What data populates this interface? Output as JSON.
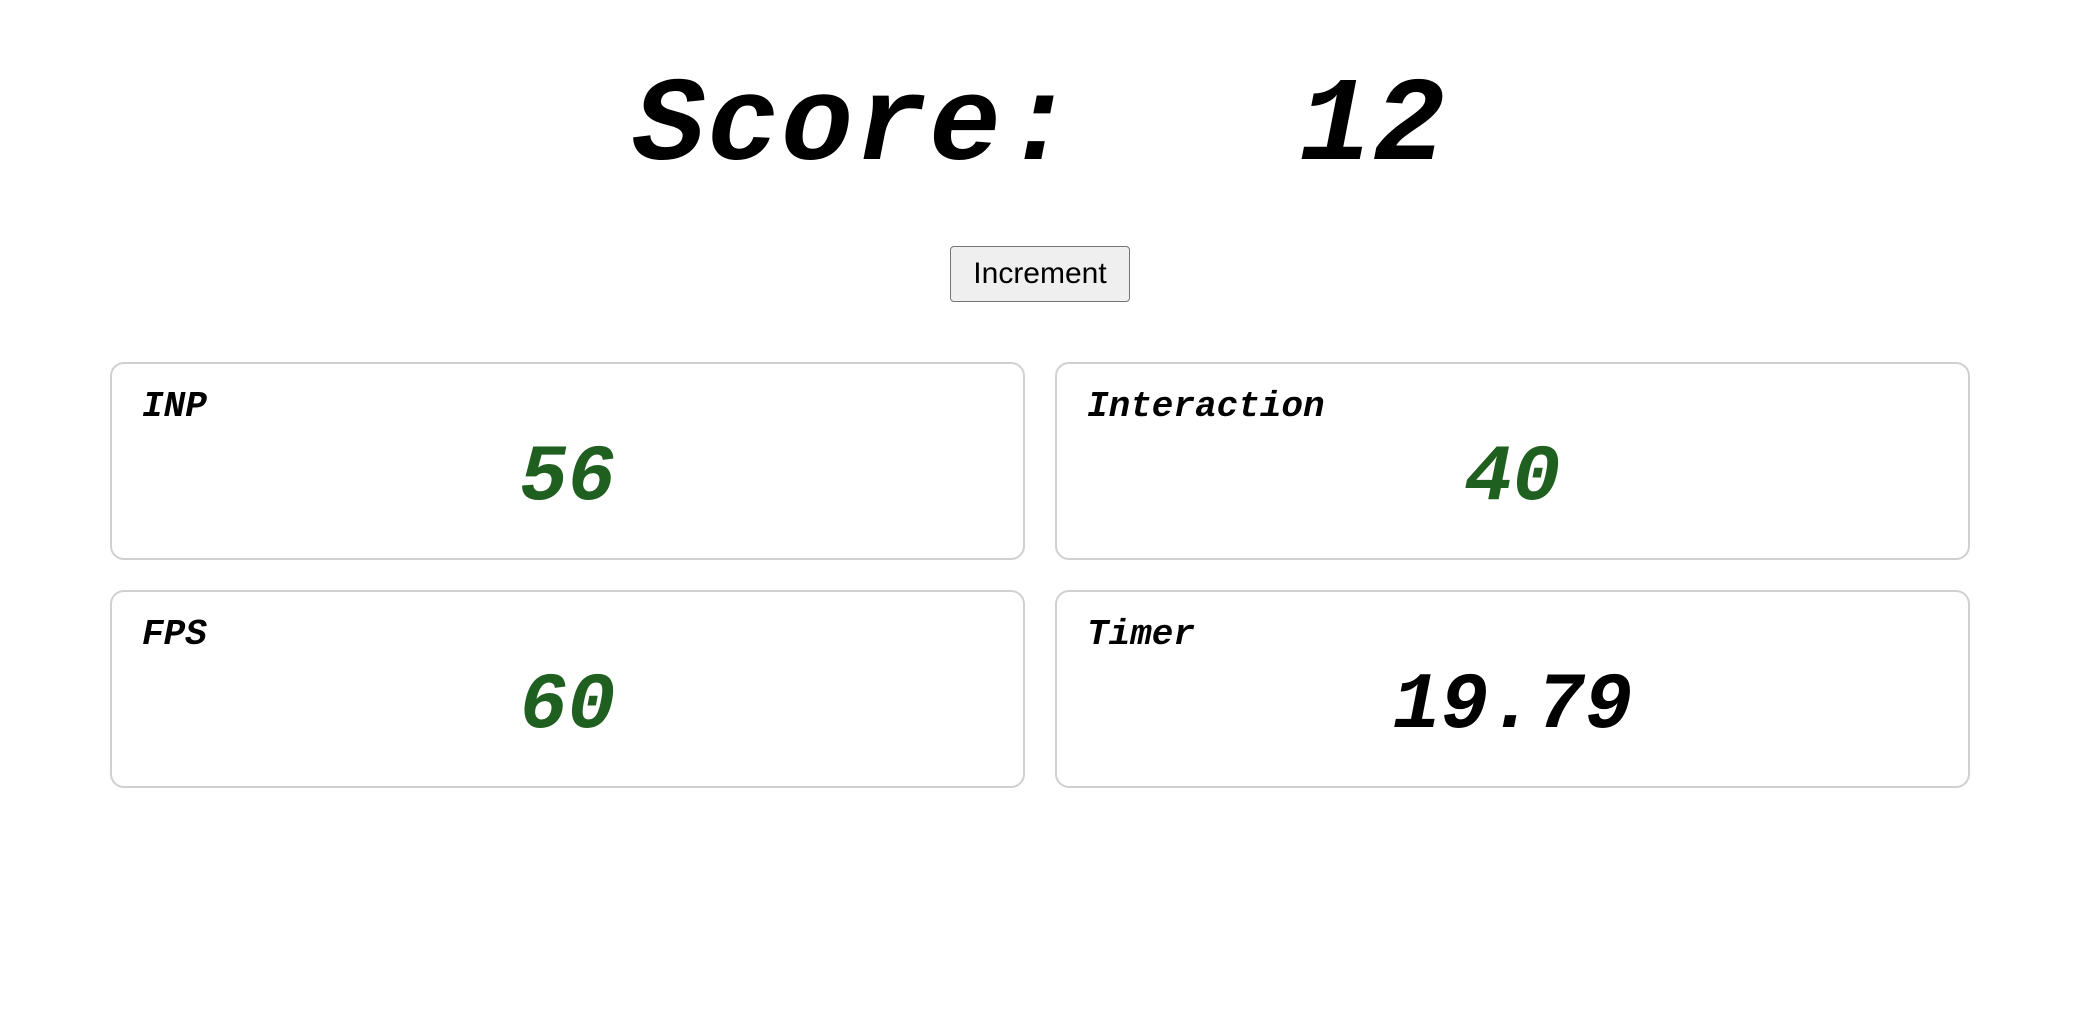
{
  "score": {
    "label": "Score:",
    "value": "12"
  },
  "button": {
    "increment_label": "Increment"
  },
  "panels": {
    "inp": {
      "label": "INP",
      "value": "56"
    },
    "interaction": {
      "label": "Interaction",
      "value": "40"
    },
    "fps": {
      "label": "FPS",
      "value": "60"
    },
    "timer": {
      "label": "Timer",
      "value": "19.79"
    }
  }
}
